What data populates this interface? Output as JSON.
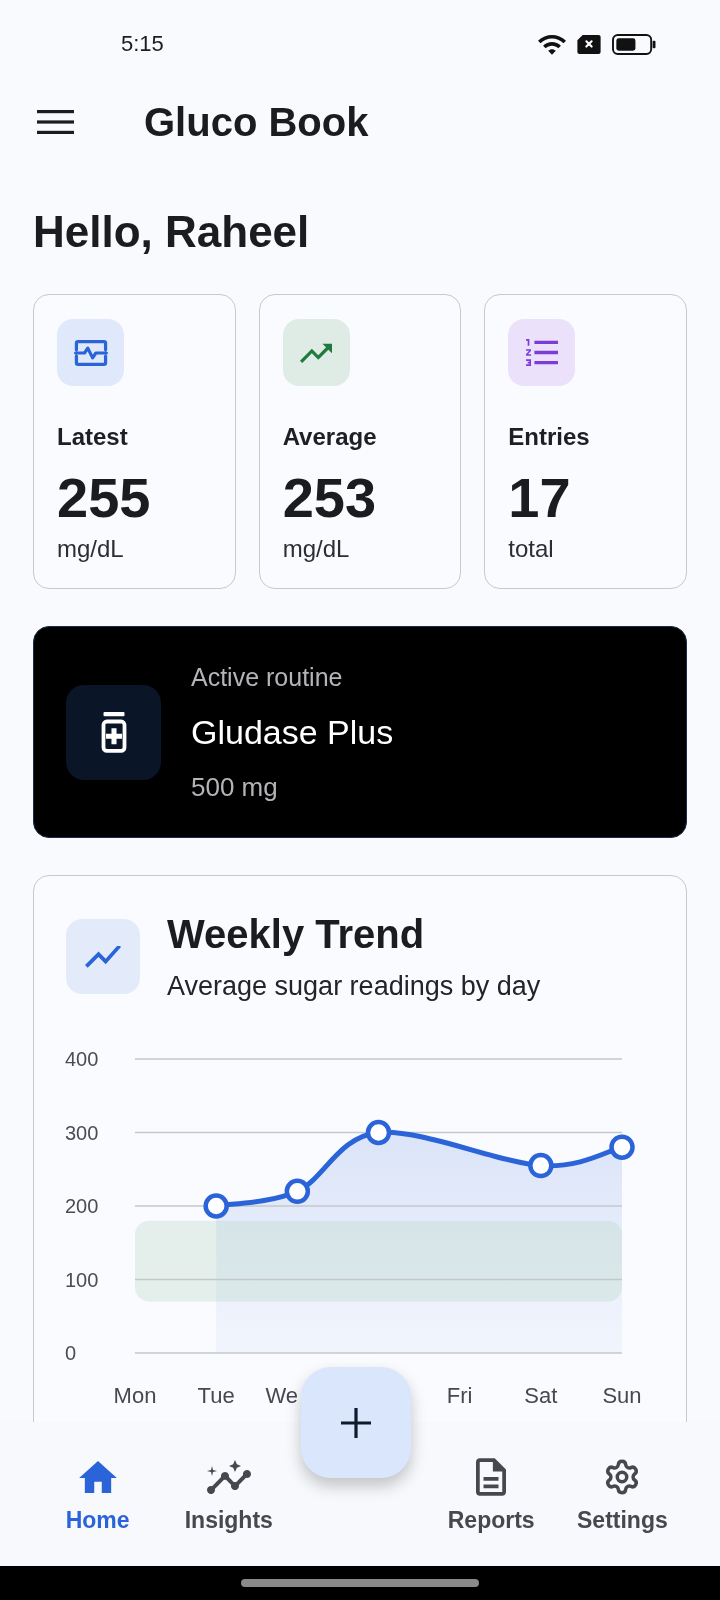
{
  "status_bar": {
    "time": "5:15"
  },
  "app_bar": {
    "title": "Gluco Book"
  },
  "greeting": "Hello, Raheel",
  "stats": [
    {
      "kind": "latest",
      "label": "Latest",
      "value": "255",
      "unit": "mg/dL"
    },
    {
      "kind": "average",
      "label": "Average",
      "value": "253",
      "unit": "mg/dL"
    },
    {
      "kind": "entries",
      "label": "Entries",
      "value": "17",
      "unit": "total"
    }
  ],
  "routine": {
    "caption": "Active routine",
    "name": "Gludase Plus",
    "dose": "500 mg"
  },
  "weekly_trend": {
    "title": "Weekly Trend",
    "subtitle": "Average sugar readings by day",
    "chart_data": {
      "type": "area",
      "categories": [
        "Mon",
        "Tue",
        "We",
        null,
        "Fri",
        "Sat",
        "Sun"
      ],
      "series": [
        {
          "color": "#2b63d9",
          "values": [
            null,
            200,
            220,
            300,
            null,
            255,
            280
          ]
        }
      ],
      "ylim": [
        0,
        400
      ],
      "yticks": [
        0,
        100,
        200,
        300,
        400
      ],
      "grid": true,
      "bands": [
        {
          "axis": "y",
          "from": 70,
          "to": 180,
          "color": "#b9d6c4"
        }
      ]
    }
  },
  "bottom_nav": [
    {
      "kind": "home",
      "label": "Home",
      "selected": true
    },
    {
      "kind": "insights",
      "label": "Insights",
      "selected": false
    },
    {
      "kind": "reports",
      "label": "Reports",
      "selected": false
    },
    {
      "kind": "settings",
      "label": "Settings",
      "selected": false
    }
  ]
}
